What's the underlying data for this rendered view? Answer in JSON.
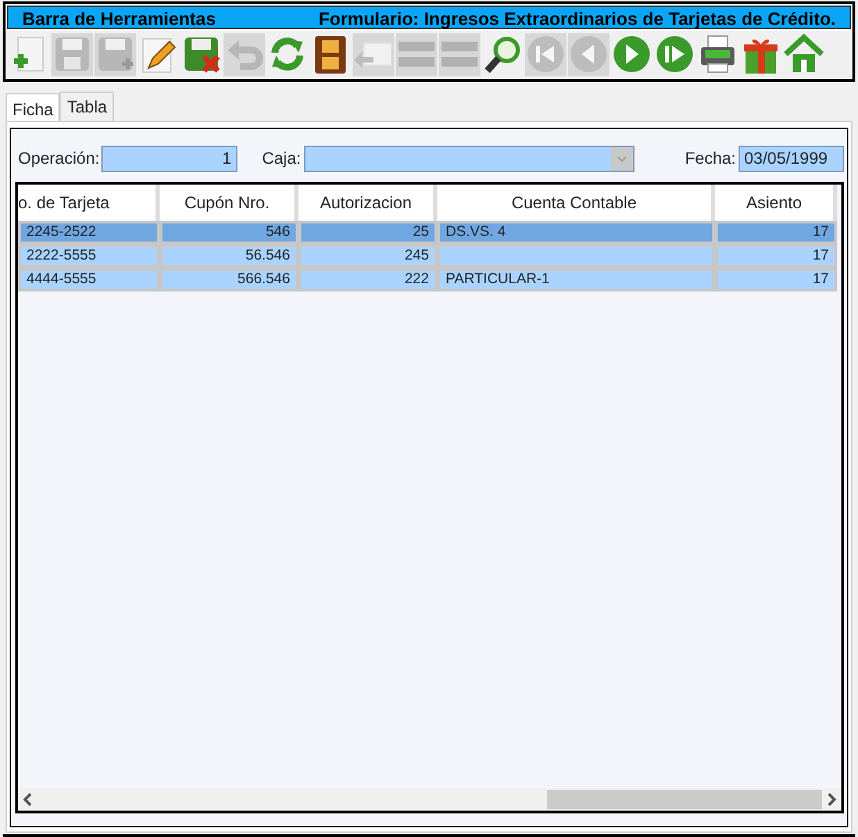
{
  "title_bar": {
    "left": "Barra de Herramientas",
    "right": "Formulario: Ingresos Extraordinarios de Tarjetas de Crédito."
  },
  "toolbar": [
    {
      "kind": "new",
      "disabled": false
    },
    {
      "kind": "save",
      "disabled": true
    },
    {
      "kind": "save-as",
      "disabled": true
    },
    {
      "kind": "edit",
      "disabled": false
    },
    {
      "kind": "cancel",
      "disabled": false
    },
    {
      "kind": "undo",
      "disabled": true
    },
    {
      "kind": "refresh",
      "disabled": false
    },
    {
      "kind": "film",
      "disabled": false
    },
    {
      "kind": "back",
      "disabled": true
    },
    {
      "kind": "list",
      "disabled": true
    },
    {
      "kind": "list",
      "disabled": true
    },
    {
      "kind": "search",
      "disabled": false
    },
    {
      "kind": "first",
      "disabled": true
    },
    {
      "kind": "prev",
      "disabled": true
    },
    {
      "kind": "next",
      "disabled": false
    },
    {
      "kind": "last",
      "disabled": false
    },
    {
      "kind": "print",
      "disabled": false
    },
    {
      "kind": "gift",
      "disabled": false
    },
    {
      "kind": "home",
      "disabled": false
    }
  ],
  "tabs": [
    {
      "label": "Ficha",
      "selected": true
    },
    {
      "label": "Tabla",
      "selected": false
    }
  ],
  "form": {
    "operacion_label": "Operación:",
    "operacion": "1",
    "caja_label": "Caja:",
    "fecha_label": "Fecha:",
    "fecha": "03/05/1999"
  },
  "table": {
    "columns": [
      "o. de Tarjeta",
      "Cupón Nro.",
      "Autorizacion",
      "Cuenta Contable",
      "Asiento"
    ],
    "rows": [
      {
        "selected": true,
        "cells": [
          "2245-2522",
          "546",
          "25",
          "DS.VS. 4",
          "17"
        ]
      },
      {
        "selected": false,
        "cells": [
          "2222-5555",
          "56.546",
          "245",
          "",
          "17"
        ]
      },
      {
        "selected": false,
        "cells": [
          "4444-5555",
          "566.546",
          "222",
          "PARTICULAR-1",
          "17"
        ]
      }
    ]
  }
}
